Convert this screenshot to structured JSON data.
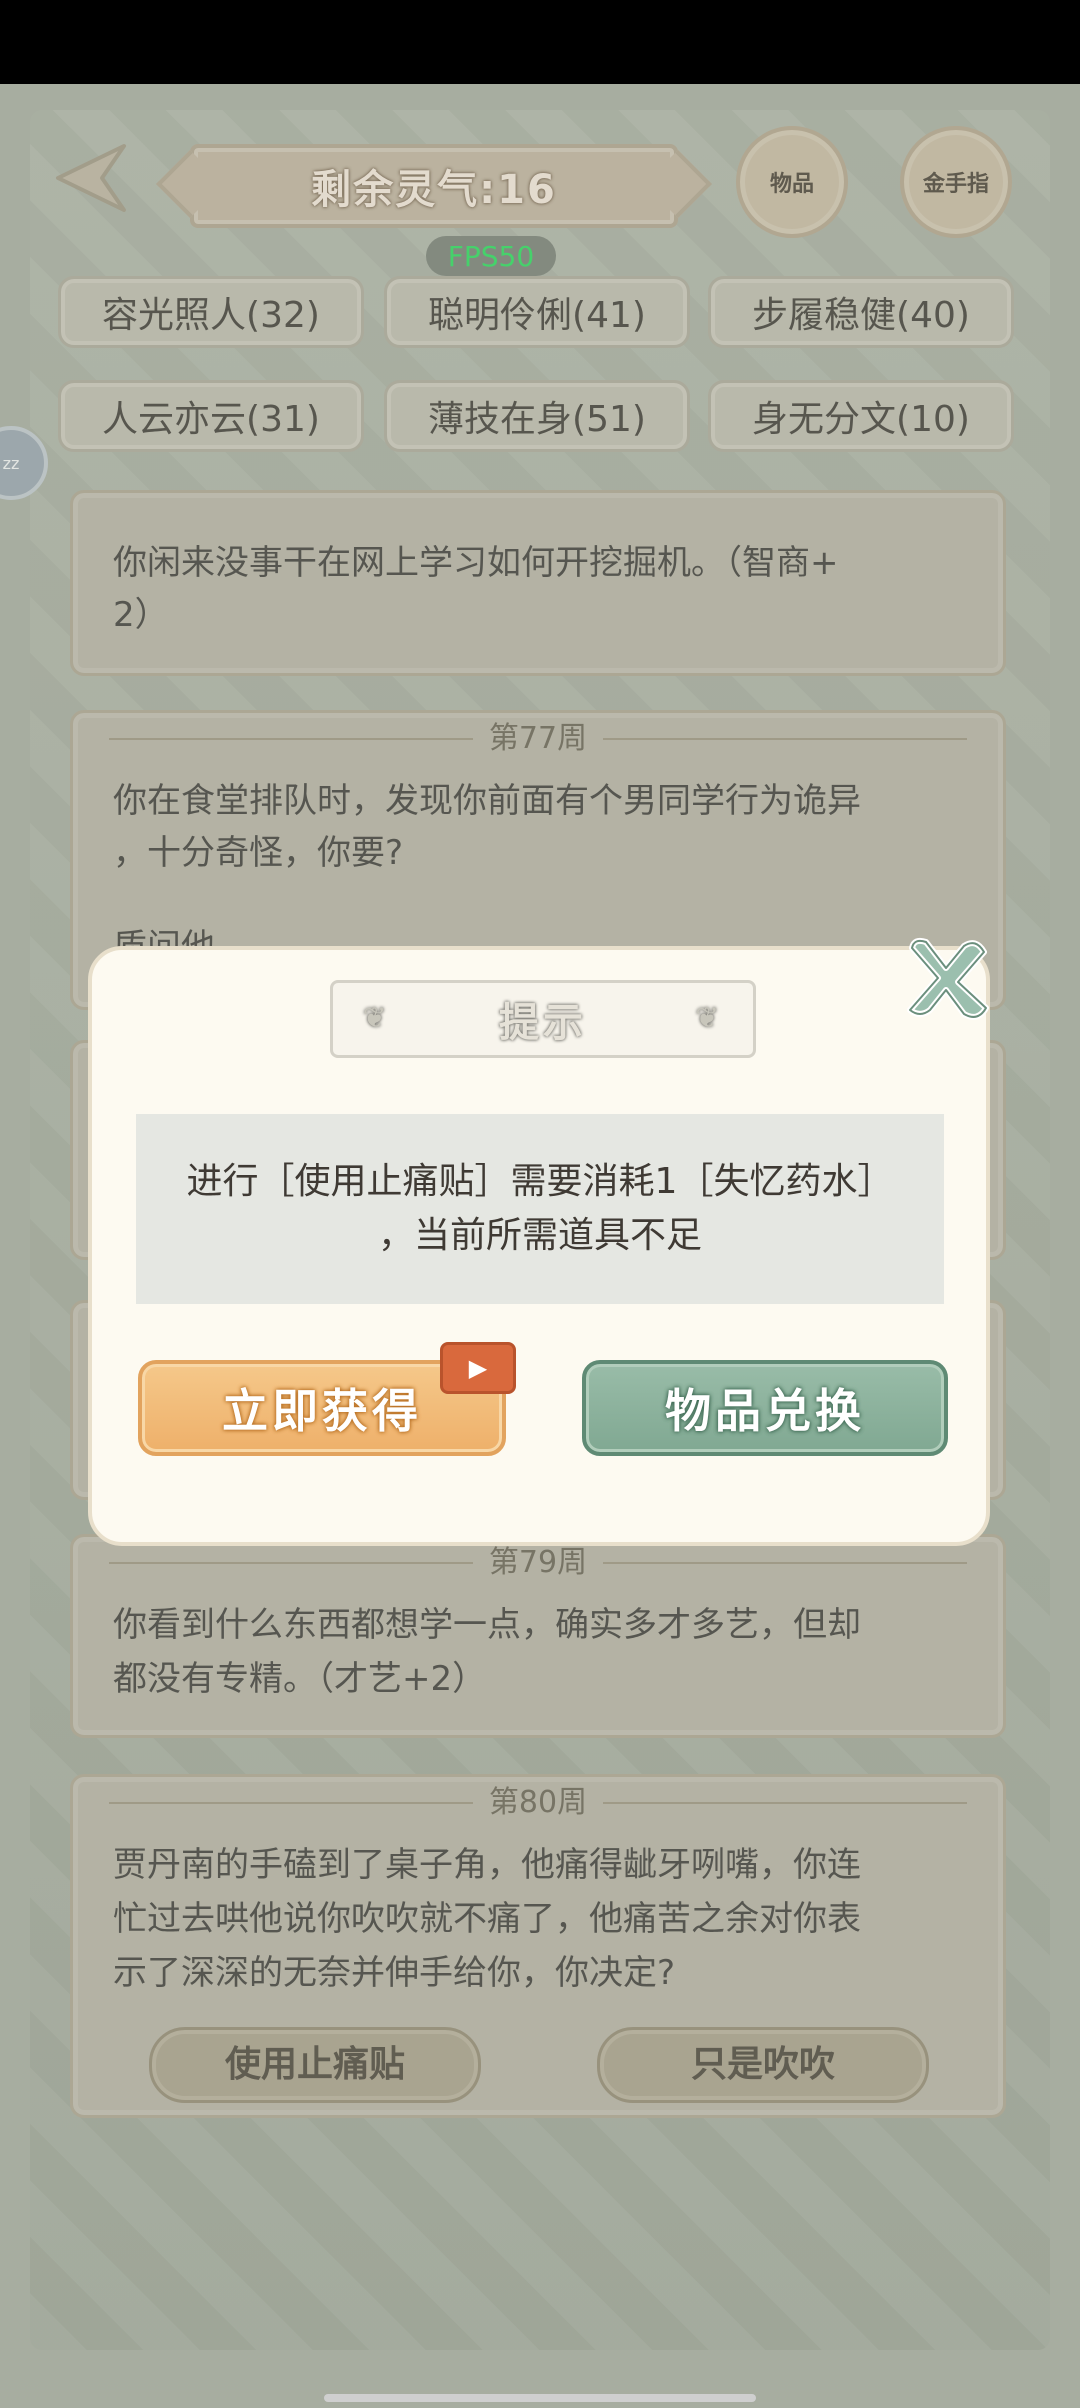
{
  "header": {
    "title": "剩余灵气:16",
    "items_label": "物品",
    "goldfinger_label": "金手指",
    "fps": "FPS50"
  },
  "tags": [
    "容光照人(32)",
    "聪明伶俐(41)",
    "步履稳健(40)",
    "人云亦云(31)",
    "薄技在身(51)",
    "身无分文(10)"
  ],
  "side_bubble": "zz",
  "cards": {
    "prev_text_line1": "你闲来没事干在网上学习如何开挖掘机。（智商+",
    "prev_text_line2": "2）",
    "w77_week": "第77周",
    "w77_line1": "你在食堂排队时，发现你前面有个男同学行为诡异",
    "w77_line2": "，十分奇怪，你要?",
    "w77_line3": "质问他",
    "w79_week": "第79周",
    "w79_line1": "你看到什么东西都想学一点，确实多才多艺，但却",
    "w79_line2": "都没有专精。（才艺+2）",
    "w80_week": "第80周",
    "w80_line1": "贾丹南的手磕到了桌子角，他痛得龇牙咧嘴，你连",
    "w80_line2": "忙过去哄他说你吹吹就不痛了，他痛苦之余对你表",
    "w80_line3": "示了深深的无奈并伸手给你，你决定?",
    "w80_choice1": "使用止痛贴",
    "w80_choice2": "只是吹吹"
  },
  "dialog": {
    "title": "提示",
    "message_line1": "进行［使用止痛贴］需要消耗1［失忆药水］",
    "message_line2": "，当前所需道具不足",
    "get_button": "立即获得",
    "exchange_button": "物品兑换"
  },
  "icons": {
    "back": "back-arrow-icon",
    "close": "close-icon",
    "video": "video-play-icon"
  }
}
